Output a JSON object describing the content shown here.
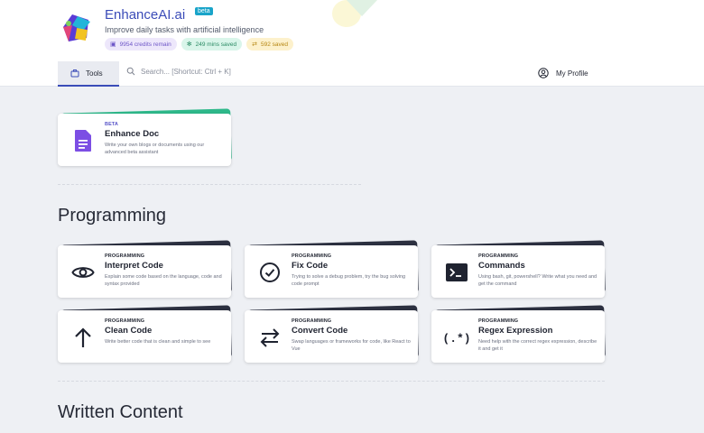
{
  "header": {
    "brand": "EnhanceAI.ai",
    "badge": "beta",
    "tagline": "Improve daily tasks with artificial intelligence",
    "chips": {
      "credits": "9954 credits remain",
      "time": "249 mins saved",
      "saved": "592 saved"
    },
    "colors": {
      "brand": "#3b4cb8",
      "accent_purple": "#7c4ee4"
    }
  },
  "nav": {
    "tools_label": "Tools",
    "search_placeholder": "Search... [Shortcut: Ctrl + K]",
    "profile_label": "My Profile"
  },
  "featured": {
    "category": "BETA",
    "title": "Enhance Doc",
    "description": "Write your own blogs or documents using our advanced beta assistant",
    "icon": "document-icon"
  },
  "sections": {
    "programming": {
      "title": "Programming",
      "cards": [
        {
          "category": "PROGRAMMING",
          "title": "Interpret Code",
          "description": "Explain some code based on the language, code and syntax provided",
          "icon": "eye-icon"
        },
        {
          "category": "PROGRAMMING",
          "title": "Fix Code",
          "description": "Trying to solve a debug problem, try the bug solving code prompt",
          "icon": "check-circle-icon"
        },
        {
          "category": "PROGRAMMING",
          "title": "Commands",
          "description": "Using bash, git, powershell? Write what you need and get the command",
          "icon": "terminal-icon"
        },
        {
          "category": "PROGRAMMING",
          "title": "Clean Code",
          "description": "Write better code that is clean and simple to see",
          "icon": "arrow-up-icon"
        },
        {
          "category": "PROGRAMMING",
          "title": "Convert Code",
          "description": "Swap languages or frameworks for code, like React to Vue",
          "icon": "swap-arrows-icon"
        },
        {
          "category": "PROGRAMMING",
          "title": "Regex Expression",
          "description": "Need help with the correct regex expression, describe it and get it",
          "icon": "regex-icon"
        }
      ]
    },
    "written": {
      "title": "Written Content"
    }
  }
}
